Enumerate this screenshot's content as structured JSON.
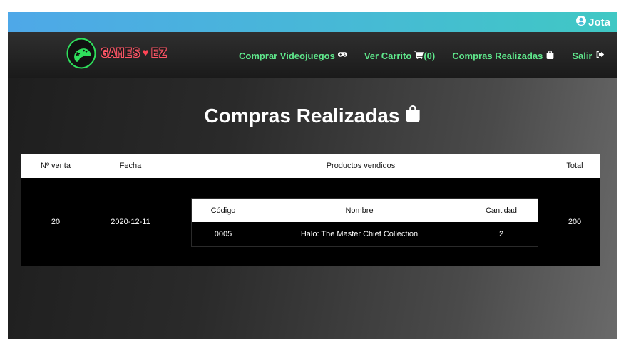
{
  "user": {
    "name": "Jota",
    "icon": "user-circle-icon"
  },
  "brand": {
    "text_left": "GAMES",
    "heart": "♥",
    "text_right": "EZ"
  },
  "nav": [
    {
      "label": "Comprar Videojuegos",
      "icon": "gamepad-icon"
    },
    {
      "label": "Ver Carrito",
      "icon": "cart-icon",
      "count": "(0)"
    },
    {
      "label": "Compras Realizadas",
      "icon": "shopping-bag-icon"
    },
    {
      "label": "Salir",
      "icon": "sign-out-icon"
    }
  ],
  "page": {
    "title": "Compras Realizadas",
    "title_icon": "shopping-bag-icon"
  },
  "orders": {
    "headers": {
      "id": "Nº venta",
      "date": "Fecha",
      "products": "Productos vendidos",
      "total": "Total"
    },
    "rows": [
      {
        "id": "20",
        "date": "2020-12-11",
        "total": "200",
        "products": {
          "headers": {
            "code": "Código",
            "name": "Nombre",
            "qty": "Cantidad"
          },
          "items": [
            {
              "code": "0005",
              "name": "Halo: The Master Chief Collection",
              "qty": "2"
            }
          ]
        }
      }
    ]
  },
  "colors": {
    "nav_link": "#5fe88c",
    "topbar_start": "#4ea8e8",
    "topbar_end": "#40c8c4",
    "brand": "#ff5566"
  }
}
